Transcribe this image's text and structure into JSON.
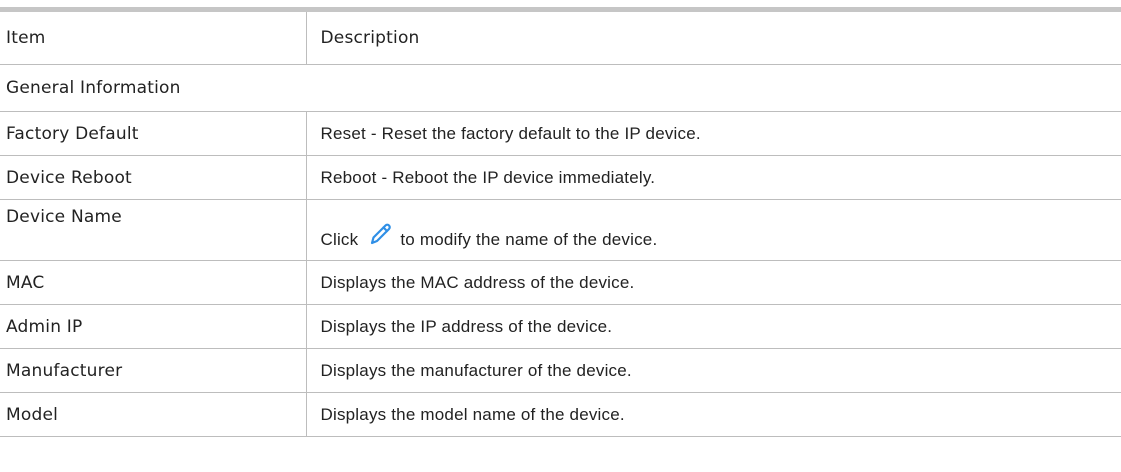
{
  "table": {
    "header": {
      "item": "Item",
      "description": "Description"
    },
    "section_title": "General Information",
    "rows": [
      {
        "item": "Factory Default",
        "description": "Reset - Reset the factory default to the IP device."
      },
      {
        "item": "Device Reboot",
        "description": "Reboot - Reboot the IP device immediately."
      },
      {
        "item": "Device Name",
        "description_before": "Click",
        "icon": "pencil-edit-icon",
        "description_after": "to modify the name of the device."
      },
      {
        "item": "MAC",
        "description": "Displays the MAC address of the device."
      },
      {
        "item": "Admin IP",
        "description": "Displays the IP address of the device."
      },
      {
        "item": "Manufacturer",
        "description": "Displays the manufacturer of the device."
      },
      {
        "item": "Model",
        "description": "Displays the model name of the device."
      }
    ]
  },
  "colors": {
    "top_rule": "#c6c6c6",
    "grid_line": "#bdbdbd",
    "icon_blue": "#2f8fe6",
    "text": "#222222"
  }
}
